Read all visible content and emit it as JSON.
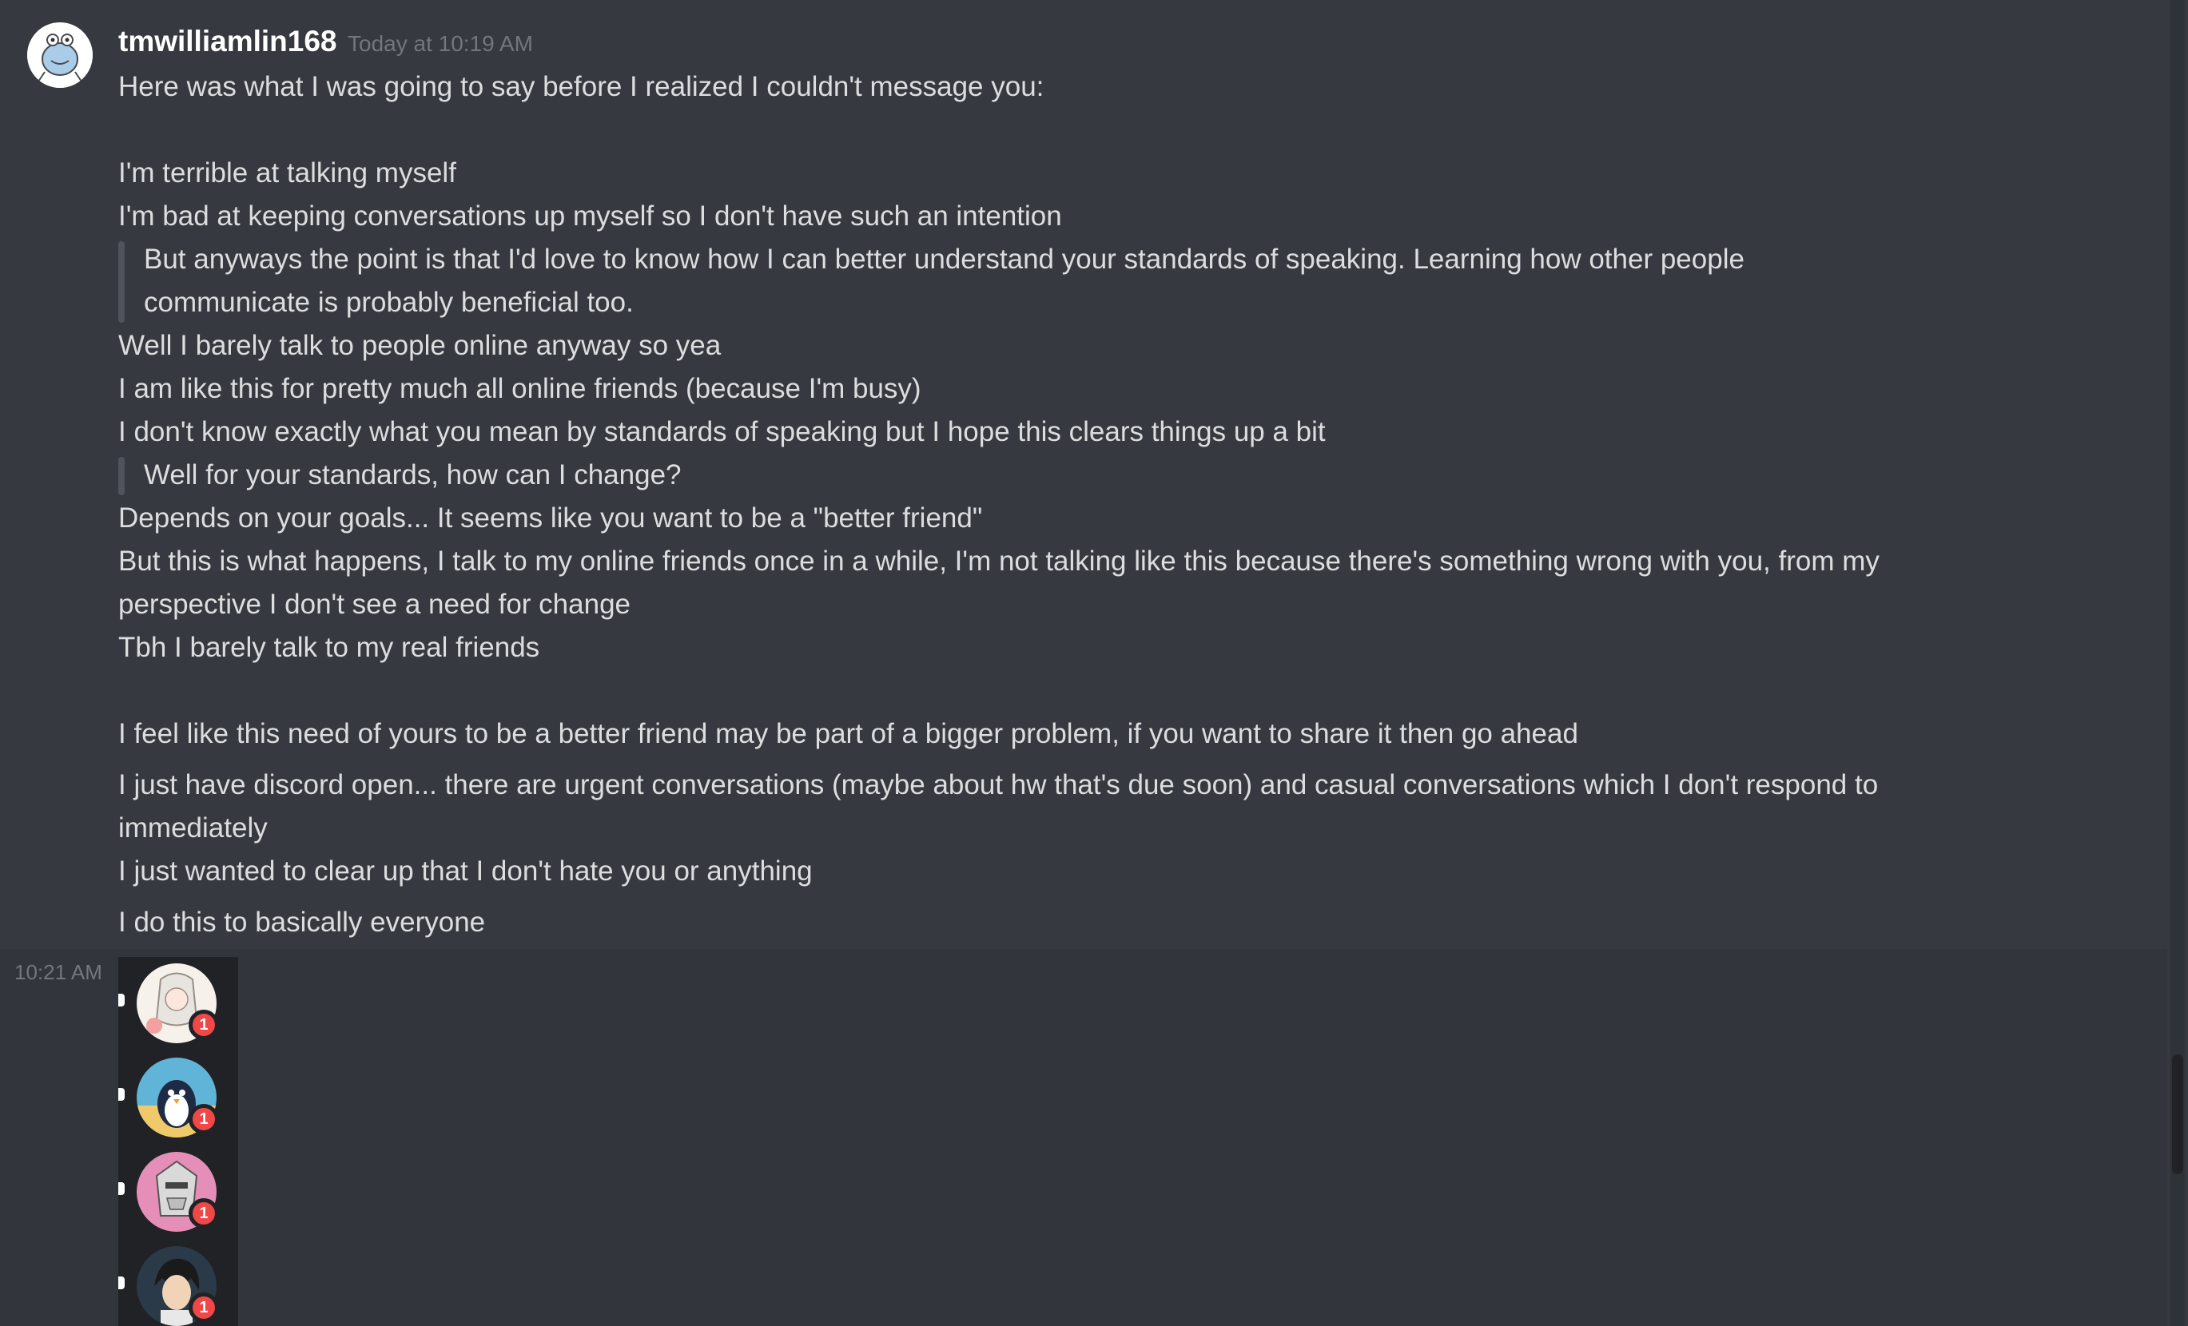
{
  "message": {
    "username": "tmwilliamlin168",
    "timestamp": "Today at 10:19 AM",
    "lines": [
      "Here was what I was going to say before I realized I couldn't message you:",
      "I'm terrible at talking myself",
      "I'm bad at keeping conversations up myself so I don't have such an intention",
      "Well I barely talk to people online anyway so yea",
      "I am like this for pretty much all online friends (because I'm busy)",
      "I don't know exactly what you mean by standards of speaking but I hope this clears things up a bit",
      "Depends on your goals... It seems like you want to be a \"better friend\"",
      "But this is what happens, I talk to my online friends once in a while, I'm not talking like this because there's something wrong with you, from my",
      "perspective I don't see a need for change",
      "Tbh I barely talk to my real friends",
      "I feel like this need of yours to be a better friend may be part of a bigger problem, if you want to share it then go ahead",
      "I just have discord open... there are urgent conversations (maybe about hw that's due soon) and casual conversations which I don't respond to",
      "immediately",
      "I just wanted to clear up that I don't hate you or anything",
      "I do this to basically everyone"
    ],
    "quotes": [
      "But anyways the point is that I'd love to know how I can better understand your standards of speaking.  Learning how other people",
      "communicate is probably beneficial too.",
      "Well for your standards, how can I change?"
    ]
  },
  "followup": {
    "timestamp": "10:21 AM",
    "servers": [
      {
        "badge": "1",
        "icon": "anime-girl-server-icon"
      },
      {
        "badge": "1",
        "icon": "penguin-server-icon"
      },
      {
        "badge": "1",
        "icon": "robot-server-icon"
      },
      {
        "badge": "1",
        "icon": "dark-haired-character-server-icon"
      }
    ]
  },
  "colors": {
    "background": "#36393f",
    "text": "#dcddde",
    "muted": "#72767d",
    "badge": "#f04747",
    "panel": "#202225"
  }
}
